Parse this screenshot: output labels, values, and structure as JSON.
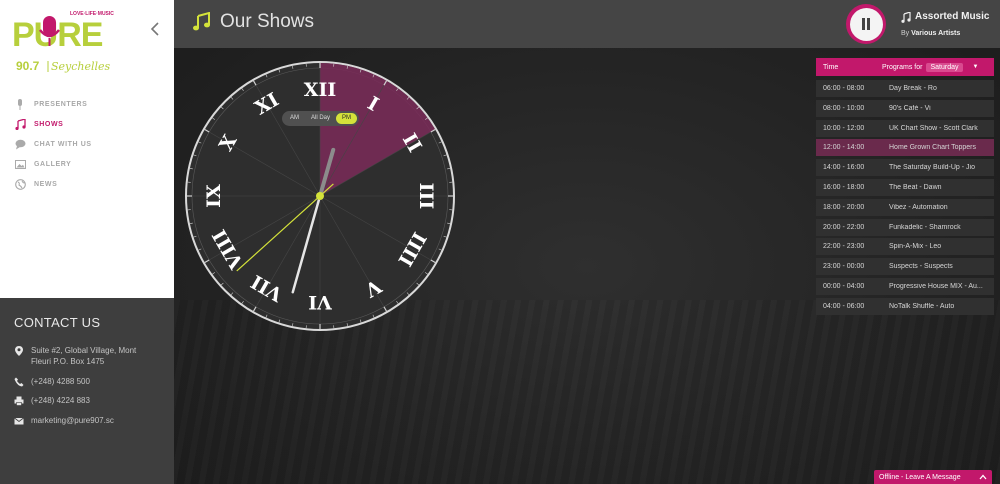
{
  "logo": {
    "brand": "PURE",
    "tagline": "LOVE·LIFE·MUSIC",
    "frequency": "90.7",
    "location": "Seychelles"
  },
  "colors": {
    "brand_magenta": "#c2186b",
    "brand_lime": "#b7cf3c",
    "accent_yellow": "#d4e23a"
  },
  "nav": [
    {
      "label": "PRESENTERS",
      "icon": "microphone-icon",
      "active": false
    },
    {
      "label": "SHOWS",
      "icon": "music-note-icon",
      "active": true
    },
    {
      "label": "CHAT WITH US",
      "icon": "chat-icon",
      "active": false
    },
    {
      "label": "GALLERY",
      "icon": "gallery-icon",
      "active": false
    },
    {
      "label": "NEWS",
      "icon": "globe-icon",
      "active": false
    }
  ],
  "contact": {
    "title": "CONTACT US",
    "address": "Suite #2, Global Village, Mont Fleuri P.O. Box 1475",
    "phone": "(+248) 4288 500",
    "fax": "(+248) 4224 883",
    "email": "marketing@pure907.sc"
  },
  "header": {
    "title": "Our Shows"
  },
  "now_playing": {
    "title": "Assorted Music",
    "by_prefix": "By",
    "artist": "Various Artists",
    "state": "playing"
  },
  "clock": {
    "numerals": [
      "XII",
      "I",
      "II",
      "III",
      "IIII",
      "V",
      "VI",
      "VII",
      "VIII",
      "IX",
      "X",
      "XI"
    ],
    "modes": [
      "AM",
      "All Day",
      "PM"
    ],
    "selected_mode": "PM",
    "highlight_hours": [
      12,
      14
    ],
    "time": {
      "hour": 12,
      "minute": 32,
      "second": 38
    }
  },
  "schedule": {
    "col_time": "Time",
    "col_programs": "Programs for",
    "day": "Saturday",
    "rows": [
      {
        "time": "06:00 - 08:00",
        "program": "Day Break - Ro",
        "current": false
      },
      {
        "time": "08:00 - 10:00",
        "program": "90's Café - Vi",
        "current": false
      },
      {
        "time": "10:00 - 12:00",
        "program": "UK Chart Show - Scott Clark",
        "current": false
      },
      {
        "time": "12:00 - 14:00",
        "program": "Home Grown Chart Toppers",
        "current": true
      },
      {
        "time": "14:00 - 16:00",
        "program": "The Saturday Build-Up - Jio",
        "current": false
      },
      {
        "time": "16:00 - 18:00",
        "program": "The Beat - Dawn",
        "current": false
      },
      {
        "time": "18:00 - 20:00",
        "program": "Vibez - Automation",
        "current": false
      },
      {
        "time": "20:00 - 22:00",
        "program": "Funkadelic - Shamrock",
        "current": false
      },
      {
        "time": "22:00 - 23:00",
        "program": "Spin-A-Mix - Leo",
        "current": false
      },
      {
        "time": "23:00 - 00:00",
        "program": "Suspects - Suspects",
        "current": false
      },
      {
        "time": "00:00 - 04:00",
        "program": "Progressive House MIX - Au...",
        "current": false
      },
      {
        "time": "04:00 - 06:00",
        "program": "NoTalk Shuffle - Auto",
        "current": false
      }
    ]
  },
  "chat": {
    "label": "Offline - Leave A Message"
  }
}
